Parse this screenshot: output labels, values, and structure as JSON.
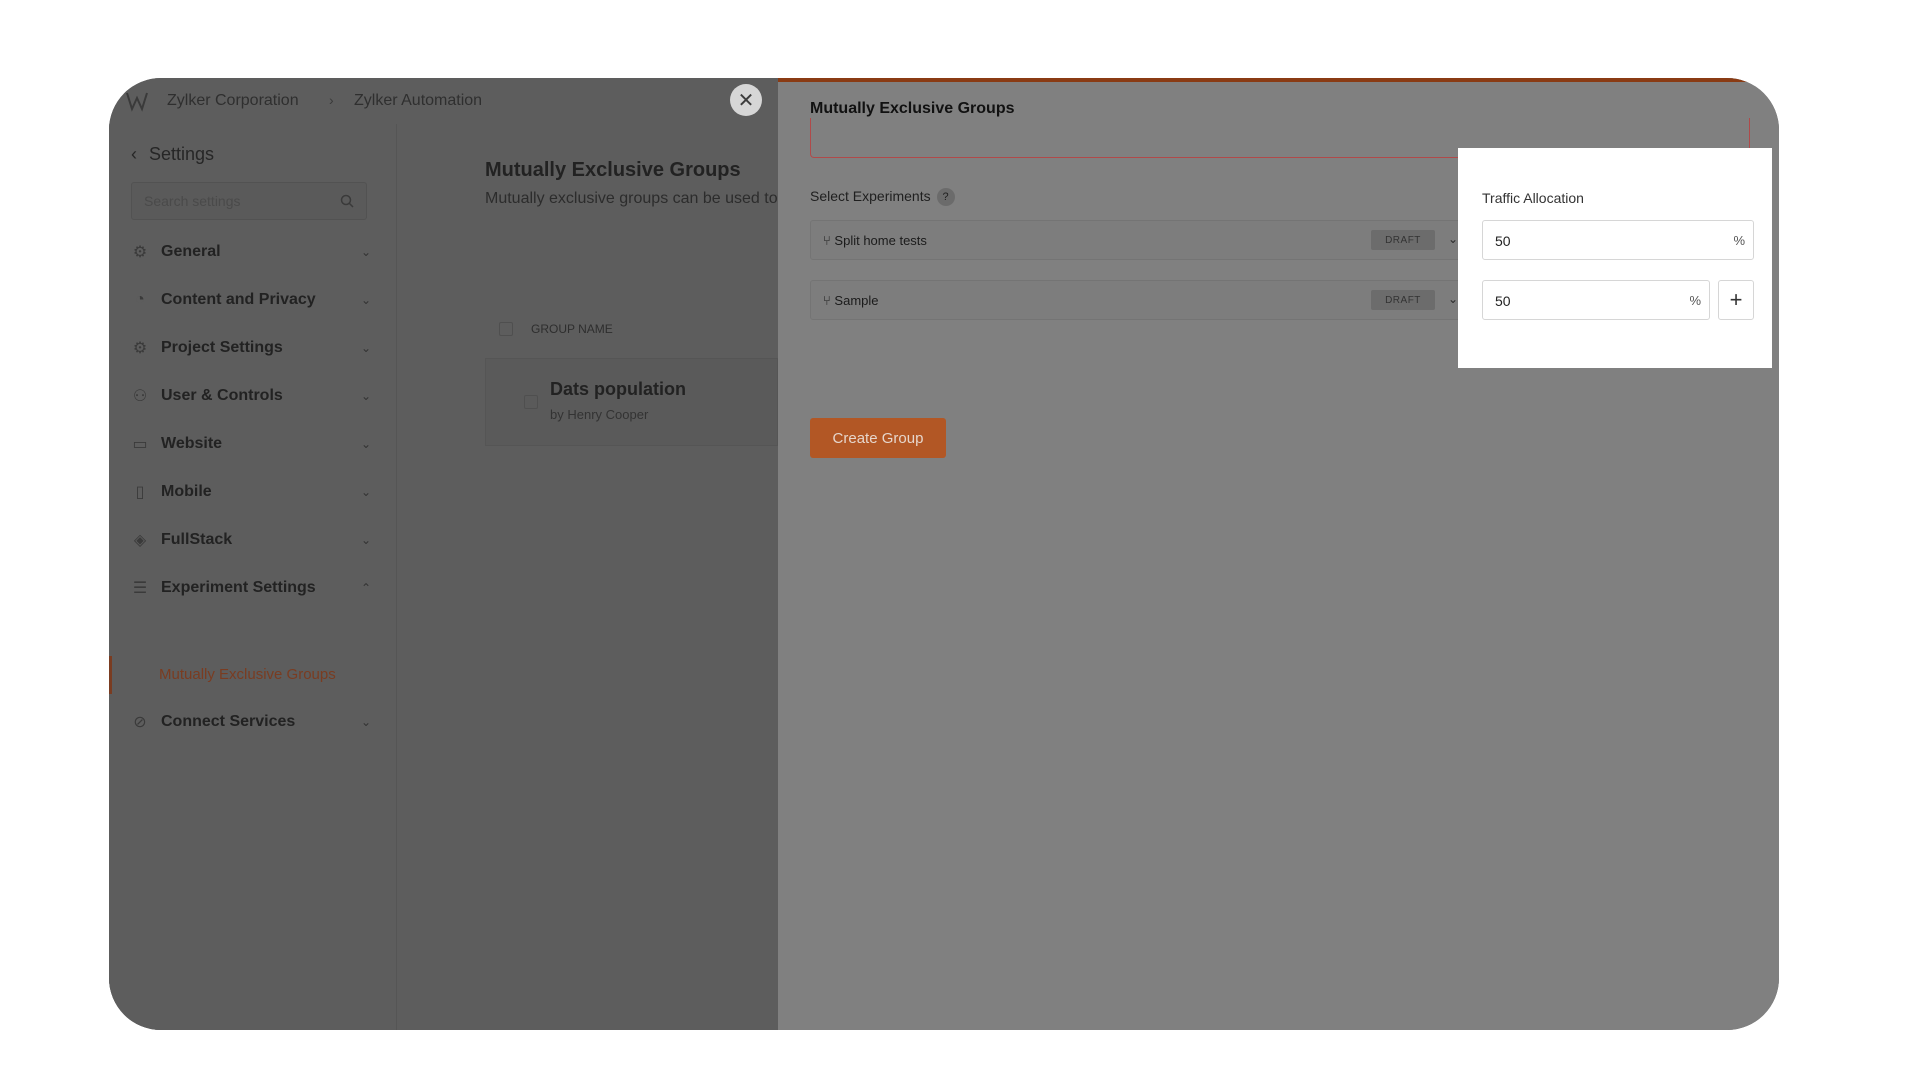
{
  "topbar": {
    "org": "Zylker Corporation",
    "project": "Zylker Automation",
    "sep": "›",
    "close": "✕"
  },
  "sidebar": {
    "title": "Settings",
    "search_placeholder": "Search settings",
    "items": [
      {
        "label": "General",
        "icon": "gear-icon"
      },
      {
        "label": "Content and Privacy",
        "icon": "privacy-icon"
      },
      {
        "label": "Project Settings",
        "icon": "gear-icon"
      },
      {
        "label": "User & Controls",
        "icon": "user-settings-icon"
      },
      {
        "label": "Website",
        "icon": "browser-icon"
      },
      {
        "label": "Mobile",
        "icon": "mobile-icon"
      },
      {
        "label": "FullStack",
        "icon": "layers-icon"
      },
      {
        "label": "Experiment Settings",
        "icon": "sliders-icon"
      },
      {
        "label": "Connect Services",
        "icon": "link-icon"
      }
    ],
    "sub_item": "Mutually Exclusive Groups"
  },
  "content": {
    "title": "Mutually Exclusive Groups",
    "description": "Mutually exclusive groups can be used to",
    "column_header": "GROUP NAME",
    "row_title": "Dats population",
    "row_sub": "by Henry Cooper"
  },
  "panel": {
    "title": "Mutually Exclusive Groups",
    "select_label": "Select Experiments",
    "help": "?",
    "experiments": [
      {
        "name": "Split home tests",
        "status": "DRAFT"
      },
      {
        "name": "Sample",
        "status": "DRAFT"
      }
    ],
    "create_button": "Create Group"
  },
  "traffic": {
    "label": "Traffic Allocation",
    "values": [
      "50",
      "50"
    ],
    "unit": "%",
    "add": "+"
  },
  "float": {
    "help": "?"
  },
  "colors": {
    "accent": "#b25725",
    "help_tab": "#1c6b2d"
  }
}
